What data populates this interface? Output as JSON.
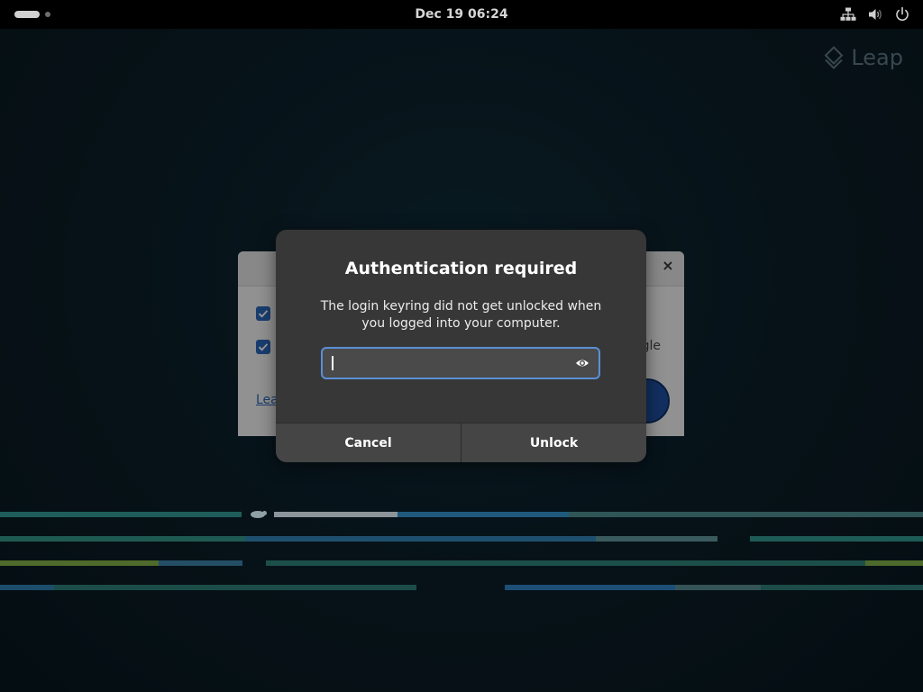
{
  "topbar": {
    "clock": "Dec 19  06:24",
    "icons": [
      "network-wired-icon",
      "volume-icon",
      "power-icon"
    ]
  },
  "brand": {
    "logo_text": "Leap",
    "logo_icon": "leap-diamond-icon"
  },
  "background_window": {
    "close_label": "×",
    "link_text": "Lea",
    "partial_text_right": "gle",
    "checkbox_1_checked": true,
    "checkbox_2_checked": true
  },
  "dialog": {
    "title": "Authentication required",
    "description": "The login keyring did not get unlocked when you logged into your computer.",
    "password": {
      "value": "",
      "placeholder": "",
      "reveal_icon": "eye-icon"
    },
    "cancel_label": "Cancel",
    "unlock_label": "Unlock"
  },
  "colors": {
    "topbar_bg": "#000000",
    "dialog_bg": "#373737",
    "button_bg": "#454545",
    "focus_ring": "#5b8fd6",
    "checkbox_blue": "#2a63b3"
  }
}
